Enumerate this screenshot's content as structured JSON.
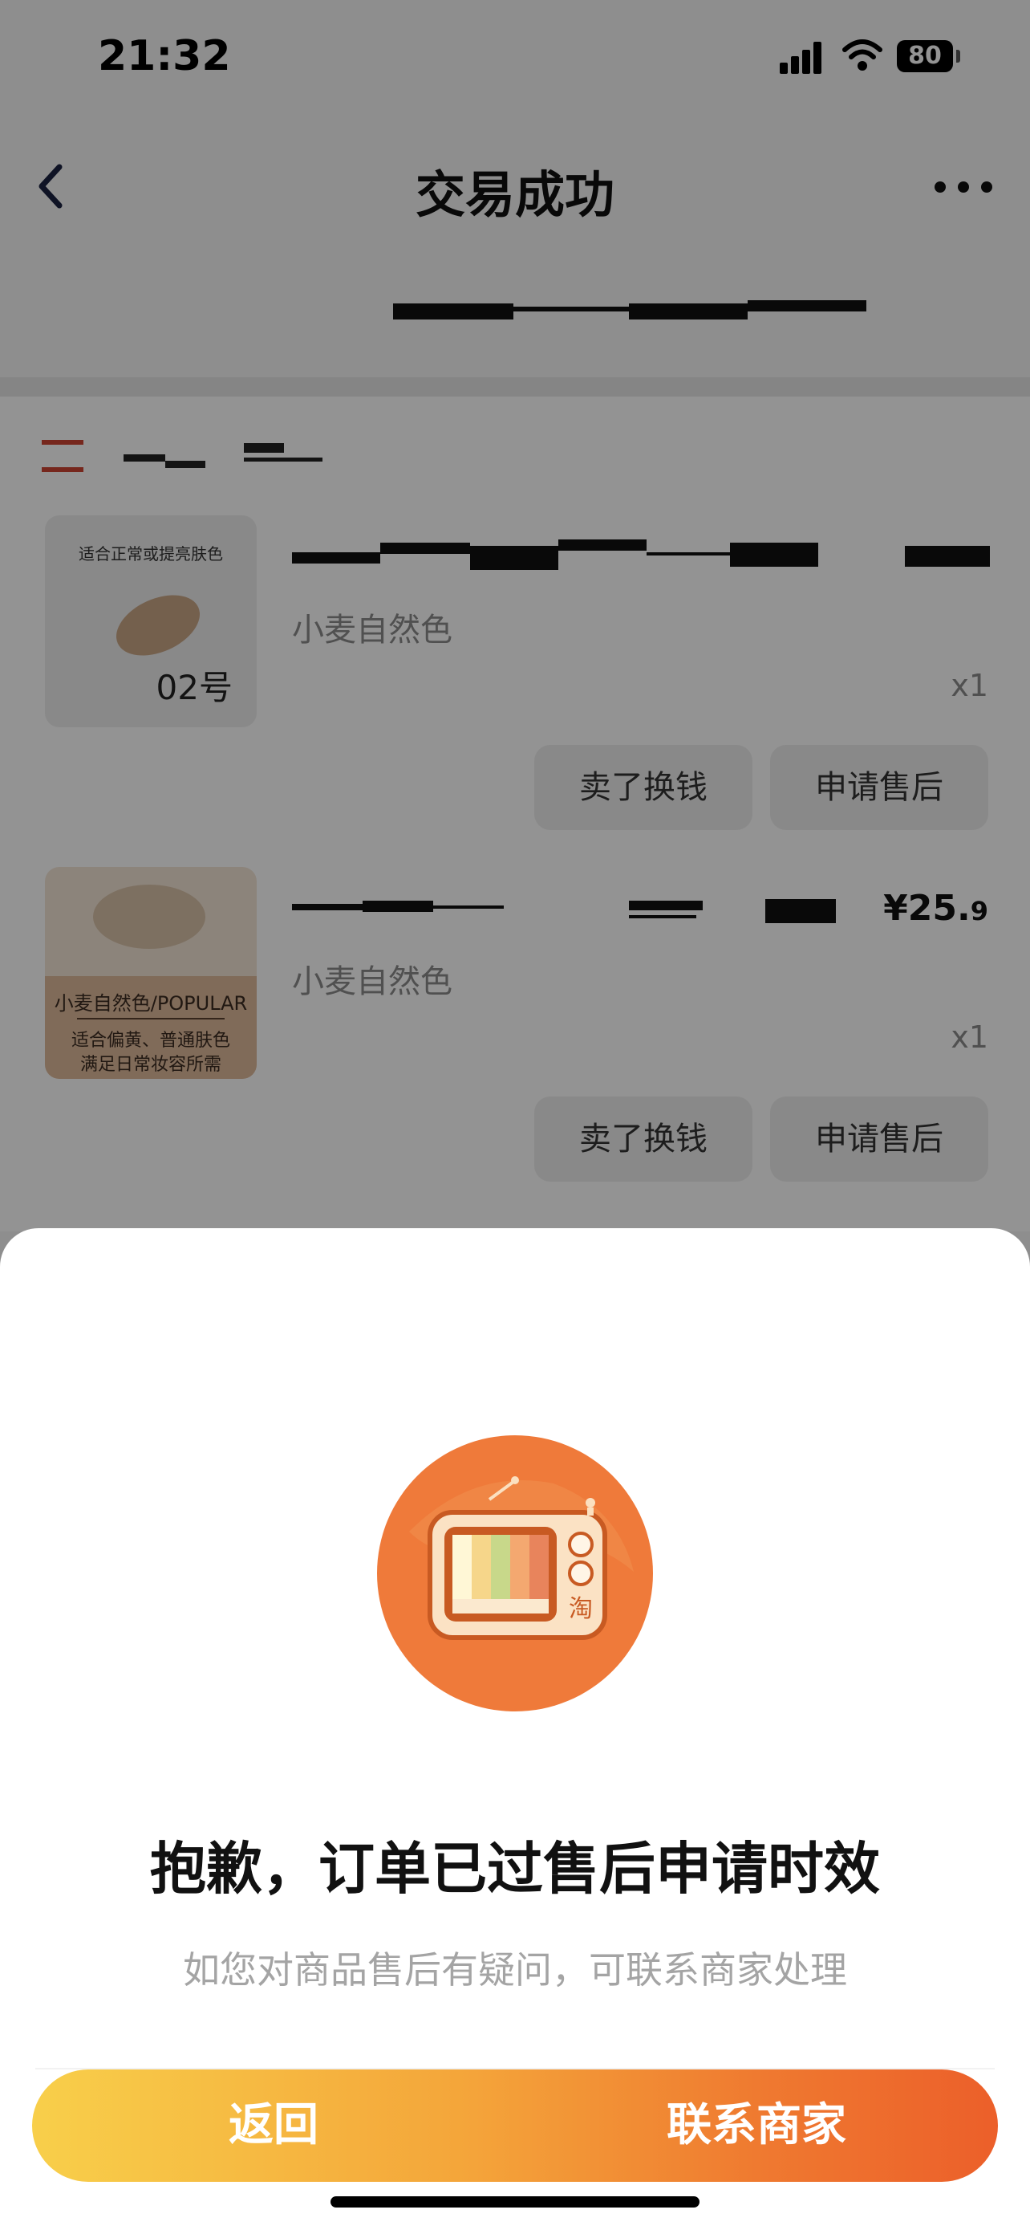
{
  "status_bar": {
    "time": "21:32",
    "battery": "80"
  },
  "nav": {
    "title": "交易成功"
  },
  "products": [
    {
      "thumb_caption": "适合正常或提亮肤色",
      "thumb_number": "02号",
      "variant": "小麦自然色",
      "quantity": "x1",
      "price_main": "",
      "price_decimal": "",
      "sell_label": "卖了换钱",
      "after_sale_label": "申请售后"
    },
    {
      "thumb_title": "小麦自然色/POPULAR",
      "thumb_desc_1": "适合偏黄、普通肤色",
      "thumb_desc_2": "满足日常妆容所需",
      "variant": "小麦自然色",
      "quantity": "x1",
      "price_main": "¥25.",
      "price_decimal": "9",
      "sell_label": "卖了换钱",
      "after_sale_label": "申请售后"
    }
  ],
  "sheet": {
    "illustration_icon": "retro-tv-icon",
    "illustration_badge": "淘",
    "title": "抱歉，订单已过售后申请时效",
    "subtitle": "如您对商品售后有疑问，可联系商家处理",
    "back_label": "返回",
    "contact_label": "联系商家"
  },
  "colors": {
    "accent_start": "#f8cf4a",
    "accent_end": "#ec5f2a",
    "illustration_bg": "#ef7a3a"
  }
}
